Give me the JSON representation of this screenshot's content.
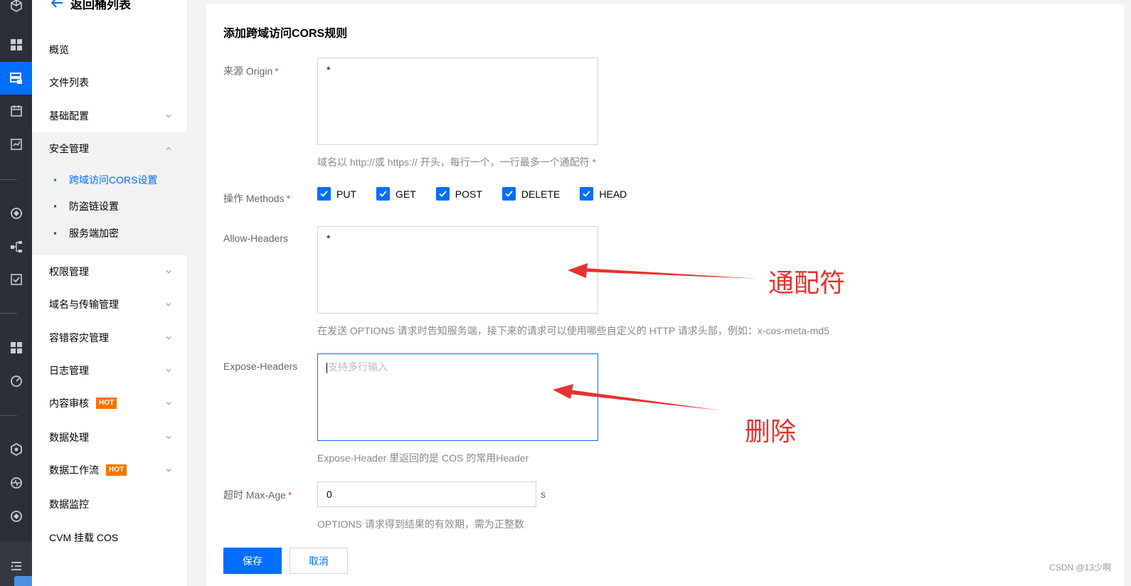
{
  "sidebar": {
    "back_label": "返回桶列表",
    "items": [
      {
        "label": "概览"
      },
      {
        "label": "文件列表"
      },
      {
        "label": "基础配置"
      },
      {
        "label": "安全管理"
      },
      {
        "label": "权限管理"
      },
      {
        "label": "域名与传输管理"
      },
      {
        "label": "容错容灾管理"
      },
      {
        "label": "日志管理"
      },
      {
        "label": "内容审核",
        "badge": "HOT"
      },
      {
        "label": "数据处理"
      },
      {
        "label": "数据工作流",
        "badge": "HOT"
      },
      {
        "label": "数据监控"
      },
      {
        "label": "CVM 挂载 COS"
      }
    ],
    "security_sub": [
      {
        "label": "跨域访问CORS设置",
        "active": true
      },
      {
        "label": "防盗链设置"
      },
      {
        "label": "服务端加密"
      }
    ]
  },
  "form": {
    "title": "添加跨域访问CORS规则",
    "origin": {
      "label": "来源 Origin",
      "required": "*",
      "value": "*",
      "hint": "域名以 http://或 https:// 开头，每行一个，一行最多一个通配符 *"
    },
    "methods": {
      "label": "操作 Methods",
      "required": "*",
      "options": [
        {
          "label": "PUT",
          "checked": true
        },
        {
          "label": "GET",
          "checked": true
        },
        {
          "label": "POST",
          "checked": true
        },
        {
          "label": "DELETE",
          "checked": true
        },
        {
          "label": "HEAD",
          "checked": true
        }
      ]
    },
    "allow_headers": {
      "label": "Allow-Headers",
      "value": "*",
      "hint": "在发送 OPTIONS 请求时告知服务端，接下来的请求可以使用哪些自定义的 HTTP 请求头部，例如：x-cos-meta-md5"
    },
    "expose_headers": {
      "label": "Expose-Headers",
      "placeholder": "支持多行输入",
      "hint": "Expose-Header 里返回的是 COS 的常用Header"
    },
    "max_age": {
      "label": "超时 Max-Age",
      "required": "*",
      "value": "0",
      "unit": "s",
      "hint": "OPTIONS 请求得到结果的有效期，需为正整数"
    },
    "save_label": "保存",
    "cancel_label": "取消"
  },
  "annotations": {
    "wildcard": "通配符",
    "delete": "删除",
    "color": "#e8322d"
  },
  "watermark": "CSDN @13少啊",
  "colors": {
    "primary": "#006eff",
    "rail": "#2b2f38",
    "hot": "#ff7200"
  }
}
